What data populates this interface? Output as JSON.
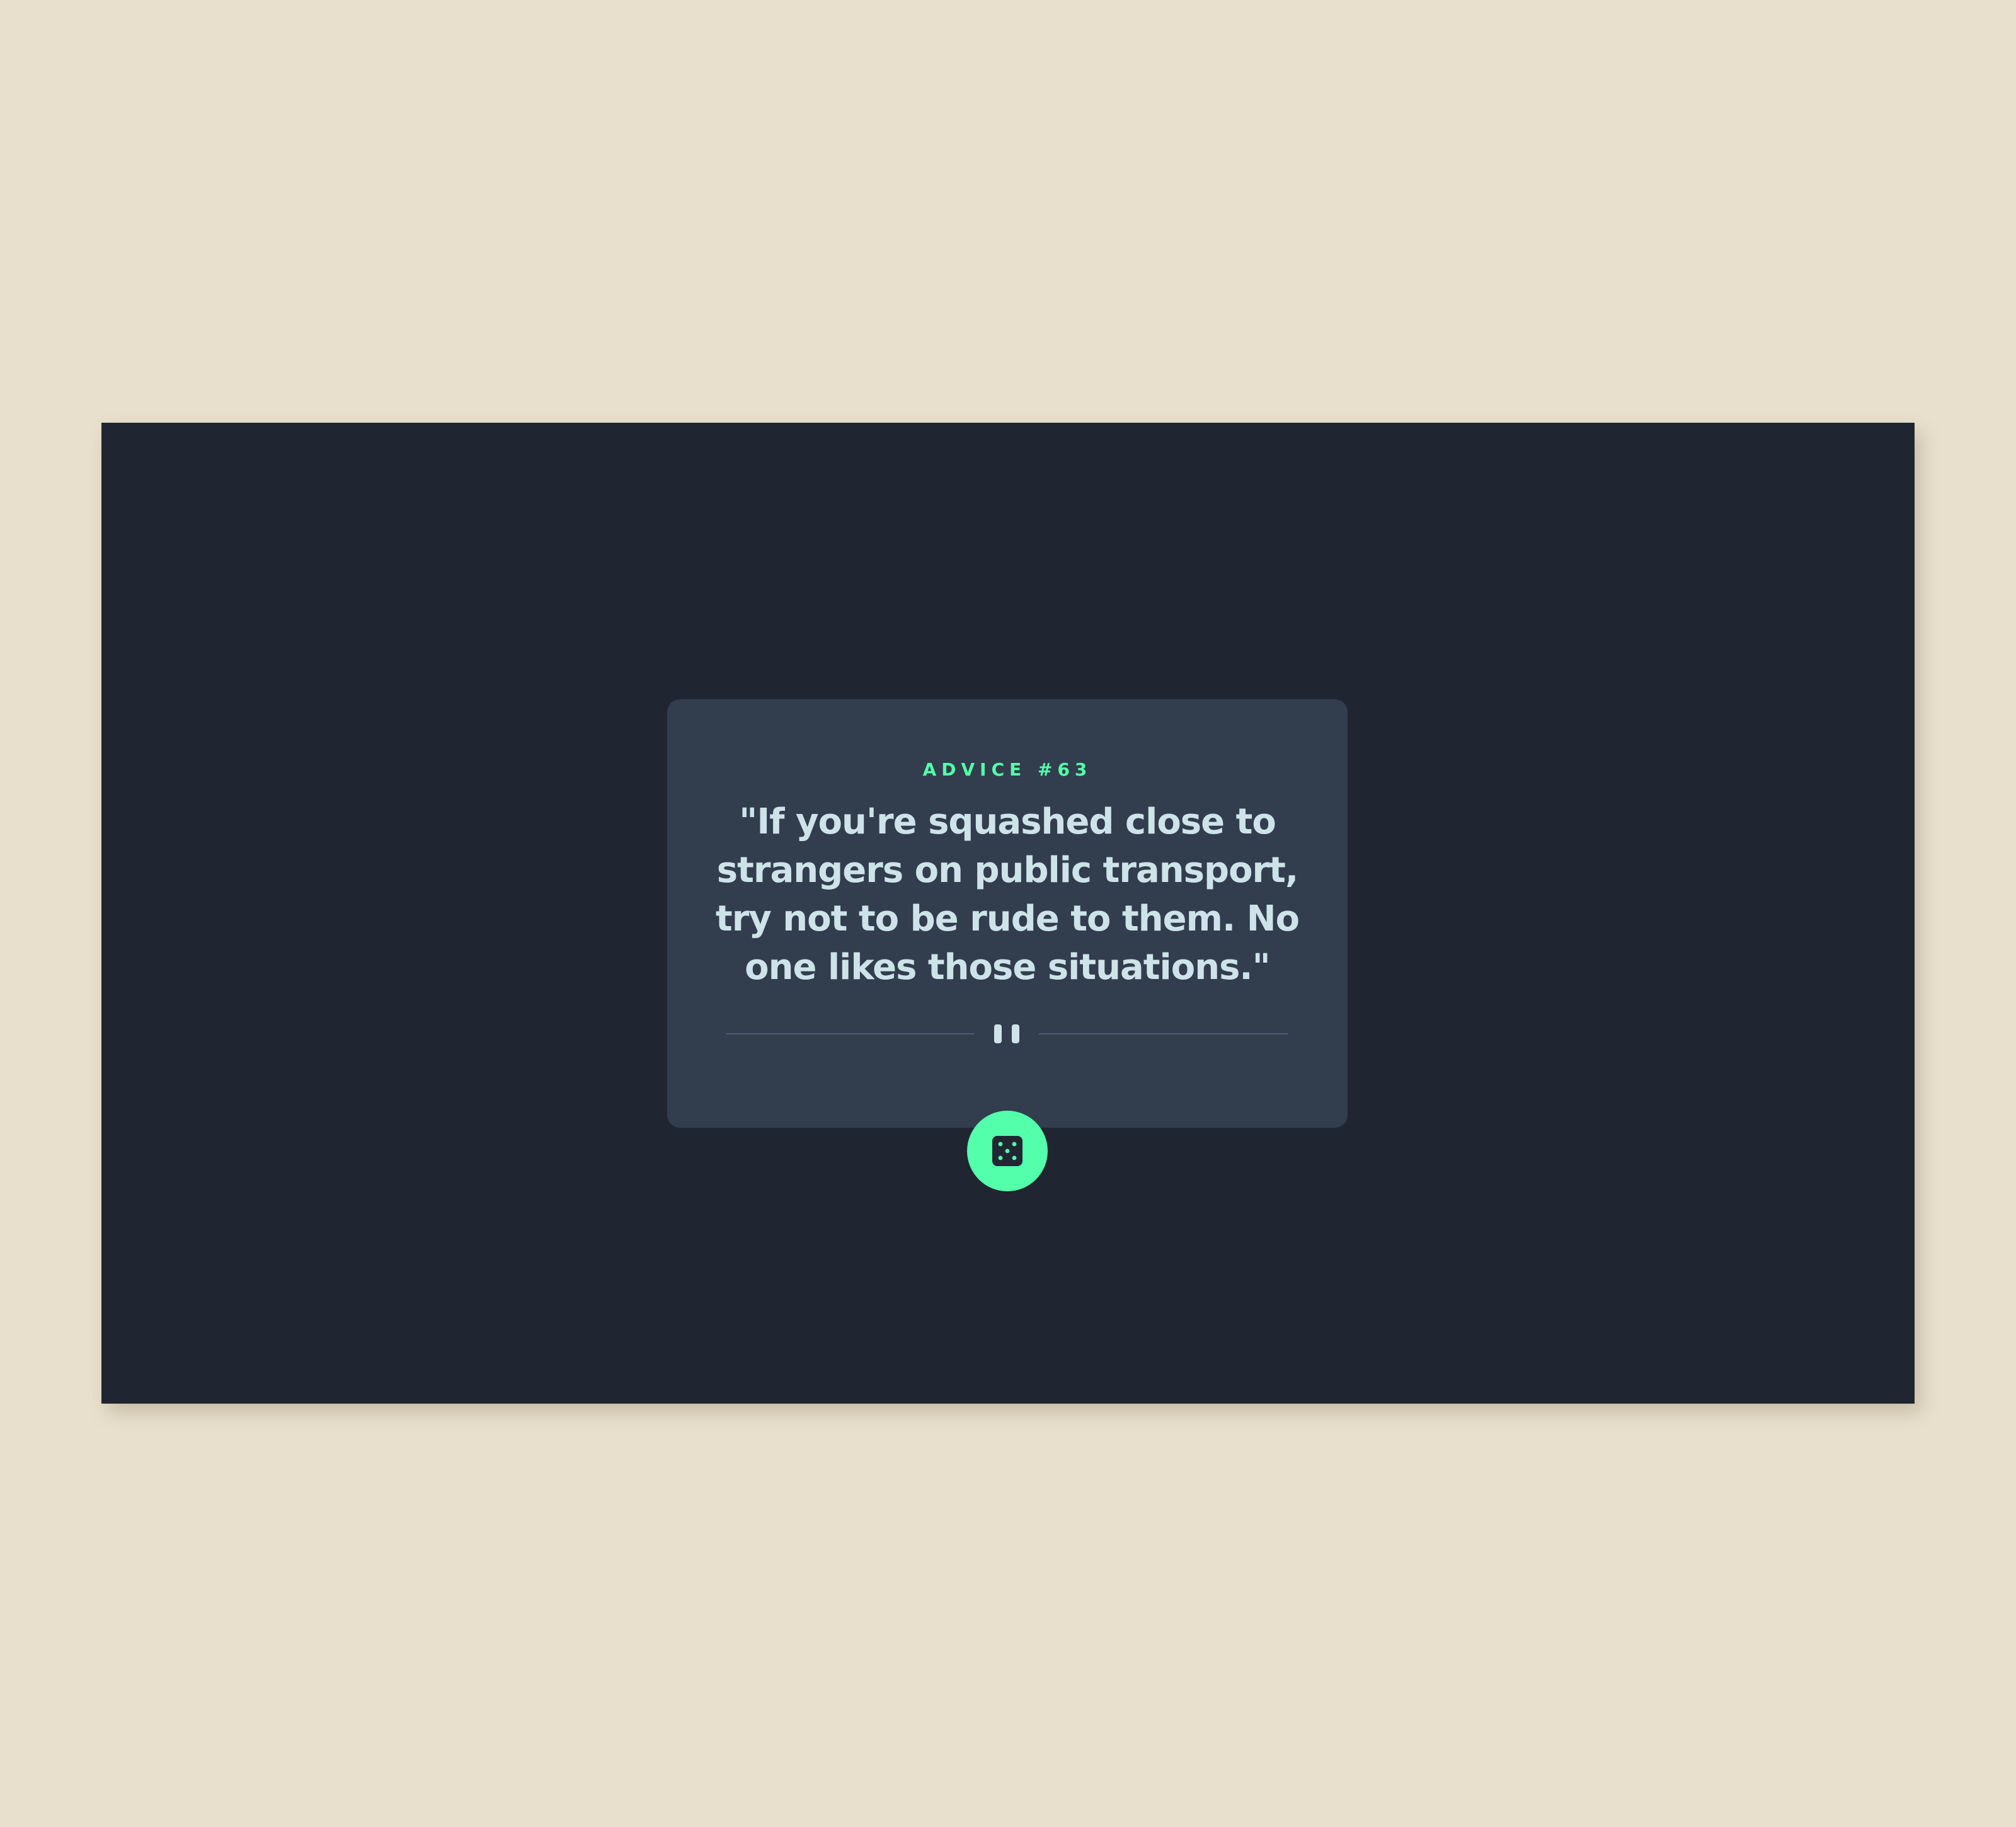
{
  "advice": {
    "label": "ADVICE #63",
    "quote": "\"If you're squashed close to strangers on public transport, try not to be rude to them. No one likes those situations.\""
  },
  "divider": {
    "icon": "pause-icon"
  },
  "button": {
    "icon": "dice-icon"
  },
  "colors": {
    "page_background": "#e8e0cd",
    "screen_background": "#1f2531",
    "card_background": "#323d4d",
    "accent": "#53ffaa",
    "text": "#cee3e9",
    "divider": "#4f5d74"
  }
}
